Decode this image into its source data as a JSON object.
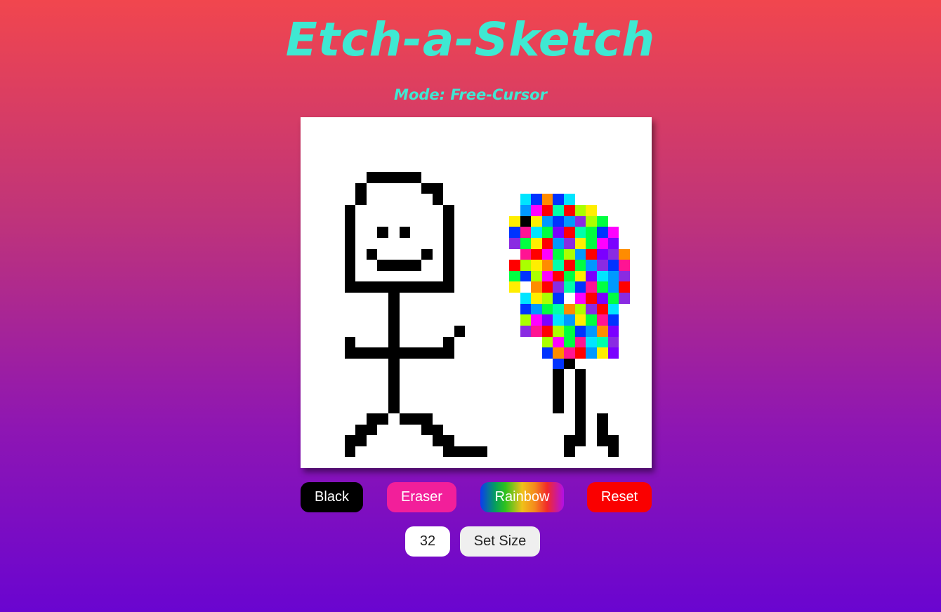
{
  "header": {
    "title": "Etch-a-Sketch",
    "mode_label": "Mode: Free-Cursor"
  },
  "colors": {
    "accent_text": "#3fe8d2",
    "background_top": "#f1464e",
    "background_bottom": "#6a05d0",
    "canvas": "#ffffff",
    "ink": "#000000",
    "black_button": "#000000",
    "eraser_button": "#f21f9a",
    "reset_button": "#fa0000"
  },
  "controls": {
    "black_label": "Black",
    "eraser_label": "Eraser",
    "rainbow_label": "Rainbow",
    "reset_label": "Reset",
    "size_value": "32",
    "set_size_label": "Set Size"
  },
  "canvas": {
    "grid_size": 32,
    "palette": [
      "#ffffff",
      "#000000",
      "#00e5ff",
      "#ff8c00",
      "#0033ff",
      "#ff00ff",
      "#ff0000",
      "#00ff40",
      "#ffee00",
      "#8a2be2",
      "#0099ff",
      "#aaff00",
      "#ff1493",
      "#00ffaa",
      "#7b00ff"
    ],
    "rows": [
      "00000000000000000000000000000000",
      "00000000000000000000000000000000",
      "00000000000000000000000000000000",
      "00000000000000000000000000000000",
      "00000000000000000000000000000000",
      "00000011111000000000000000000000",
      "00000100000110000000000000000000",
      "00000100000010000000243420000000",
      "00001000000001000000a56d6b800000",
      "0000100000000100000818a4a9b70000",
      "00001001010001000004c27e6d74500000",
      "00001000000001000009786a9875e0000",
      "00001010000101000000c657ba6e93000",
      "00001001111001000006b83d67a94c000",
      "000010000000010000074b5678e2a9000",
      "00001111111111000008f369d4c7a6000",
      "0000000010000000000028b4f56e79000",
      "000000001000000000004a7d3b962000",
      "00000000100000000000b5e2a87c40000",
      "000000001000001000009c6b74a3e0000",
      "0000100010000100000000b57c2d90000",
      "000011111111110000000043c6a8e0000",
      "0000000010000000000000041000000",
      "000000001000000000000001010000",
      "000000001000000000000001010000",
      "000000001000000000000001010000",
      "000000001000000000000001010000",
      "00000011011100000000000001010000",
      "00000110000110000000000001010000",
      "00001100000011000000000011011000",
      "00001000000001111000000010001000",
      "00000000000000000000000000000000"
    ]
  }
}
